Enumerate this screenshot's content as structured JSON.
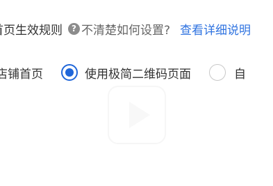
{
  "rule_row": {
    "label": "首页生效规则",
    "help_icon": "question-circle-icon",
    "help_glyph": "?",
    "help_text": "不清楚如何设置?",
    "detail_link": "查看详细说明"
  },
  "options": [
    {
      "label": "店铺首页",
      "selected": false
    },
    {
      "label": "使用极简二维码页面",
      "selected": true
    },
    {
      "label": "自",
      "selected": false
    }
  ],
  "colors": {
    "link": "#2f73e0",
    "radio_selected": "#1f66d9",
    "text": "#333333"
  }
}
